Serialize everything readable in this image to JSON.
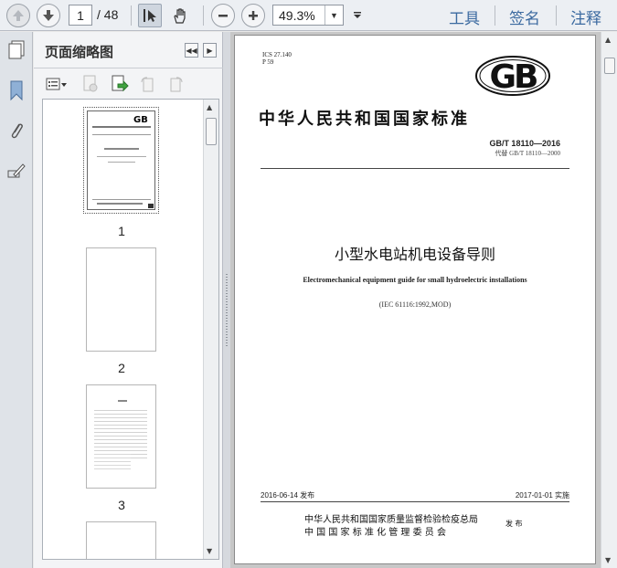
{
  "toolbar": {
    "page_current": "1",
    "page_total": "/ 48",
    "zoom_value": "49.3%",
    "menu_tools": "工具",
    "menu_sign": "签名",
    "menu_comment": "注释"
  },
  "panel": {
    "title": "页面缩略图",
    "thumbnails": [
      {
        "label": "1"
      },
      {
        "label": "2"
      },
      {
        "label": "3"
      }
    ]
  },
  "document": {
    "ics": "ICS 27.140",
    "ccs": "P 59",
    "logo": "GB",
    "standard_title": "中华人民共和国国家标准",
    "code": "GB/T  18110—2016",
    "replaces": "代替 GB/T 18110—2000",
    "title_cn": "小型水电站机电设备导则",
    "title_en": "Electromechanical equipment guide for small hydroelectric installations",
    "ref": "(IEC 61116:1992,MOD)",
    "issue_date": "2016-06-14 发布",
    "impl_date": "2017-01-01 实施",
    "issuer_1": "中华人民共和国国家质量监督检验检疫总局",
    "issuer_2": "中 国 国 家 标 准 化 管 理 委 员 会",
    "issue_word": "发 布"
  },
  "colors": {
    "menu_text": "#3b6aa0",
    "toolbar_bg": "#eceff3"
  }
}
